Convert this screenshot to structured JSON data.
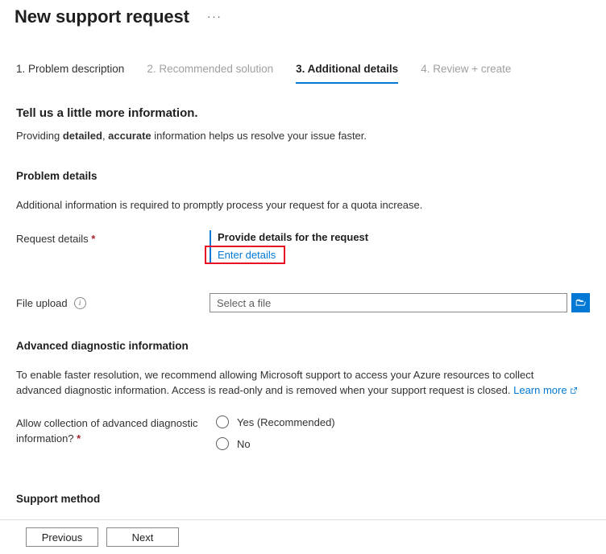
{
  "header": {
    "title": "New support request",
    "more_menu": "···"
  },
  "tabs": [
    {
      "label": "1. Problem description",
      "state": "visited"
    },
    {
      "label": "2. Recommended solution",
      "state": "disabled"
    },
    {
      "label": "3. Additional details",
      "state": "active"
    },
    {
      "label": "4. Review + create",
      "state": "disabled"
    }
  ],
  "intro": {
    "heading": "Tell us a little more information.",
    "sub_pre": "Providing ",
    "sub_bold1": "detailed",
    "sub_mid": ", ",
    "sub_bold2": "accurate",
    "sub_post": " information helps us resolve your issue faster."
  },
  "problem_details": {
    "heading": "Problem details",
    "description": "Additional information is required to promptly process your request for a quota increase.",
    "request_details_label": "Request details ",
    "required_marker": "*",
    "provide_details_title": "Provide details for the request",
    "enter_details_link": "Enter details"
  },
  "file_upload": {
    "label": "File upload",
    "info_icon_glyph": "i",
    "placeholder": "Select a file",
    "value": "",
    "browse_icon": "folder-open-icon"
  },
  "advanced": {
    "heading": "Advanced diagnostic information",
    "paragraph_pre": "To enable faster resolution, we recommend allowing Microsoft support to access your Azure resources to collect advanced diagnostic information. Access is read-only and is removed when your support request is closed. ",
    "learn_more": "Learn more",
    "radio_question": "Allow collection of advanced diagnostic information? ",
    "radio_required": "*",
    "options": [
      {
        "label": "Yes (Recommended)",
        "selected": false
      },
      {
        "label": "No",
        "selected": false
      }
    ]
  },
  "support_method": {
    "heading": "Support method"
  },
  "footer": {
    "previous": "Previous",
    "next": "Next"
  },
  "colors": {
    "accent": "#0078d4",
    "required": "#a4262c",
    "highlight": "#e81123",
    "text": "#323130",
    "disabled_text": "#a19f9d"
  }
}
